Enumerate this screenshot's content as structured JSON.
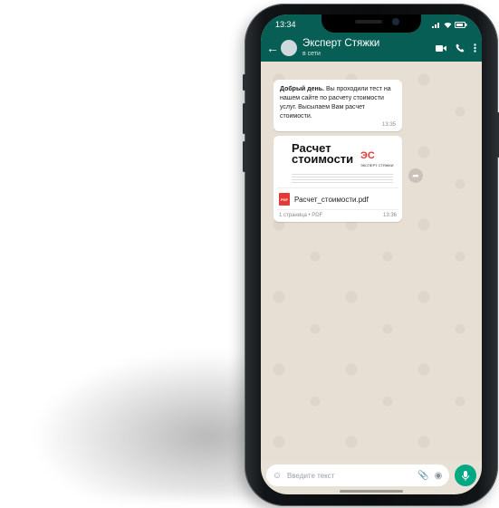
{
  "status_bar": {
    "time": "13:34"
  },
  "header": {
    "back_icon": "arrow-left-icon",
    "contact_name": "Эксперт Стяжки",
    "contact_status": "в сети",
    "icons": [
      "video-icon",
      "phone-icon",
      "more-vert-icon"
    ]
  },
  "messages": {
    "first": {
      "text_bold": "Добрый день.",
      "text": " Вы проходили тест на нашем сайте по расчету стоимости услуг. Высылаем Вам расчет стоимости.",
      "time": "13:35"
    },
    "document": {
      "preview_title_line1": "Расчет",
      "preview_title_line2": "стоимости",
      "preview_logo_text": "ЭКСПЕРТ СТЯЖКИ",
      "file_name": "Расчет_стоимости.pdf",
      "file_type_badge": "PDF",
      "file_meta": "1 страница • PDF",
      "time": "13:36"
    }
  },
  "input_bar": {
    "placeholder": "Введите текст",
    "emoji_icon": "emoji-icon",
    "attach_icon": "paperclip-icon",
    "camera_icon": "camera-icon",
    "mic_icon": "microphone-icon"
  },
  "colors": {
    "header": "#075e54",
    "chat_background": "#e7dfd3",
    "mic_button": "#00a884",
    "pdf_red": "#e53935"
  }
}
